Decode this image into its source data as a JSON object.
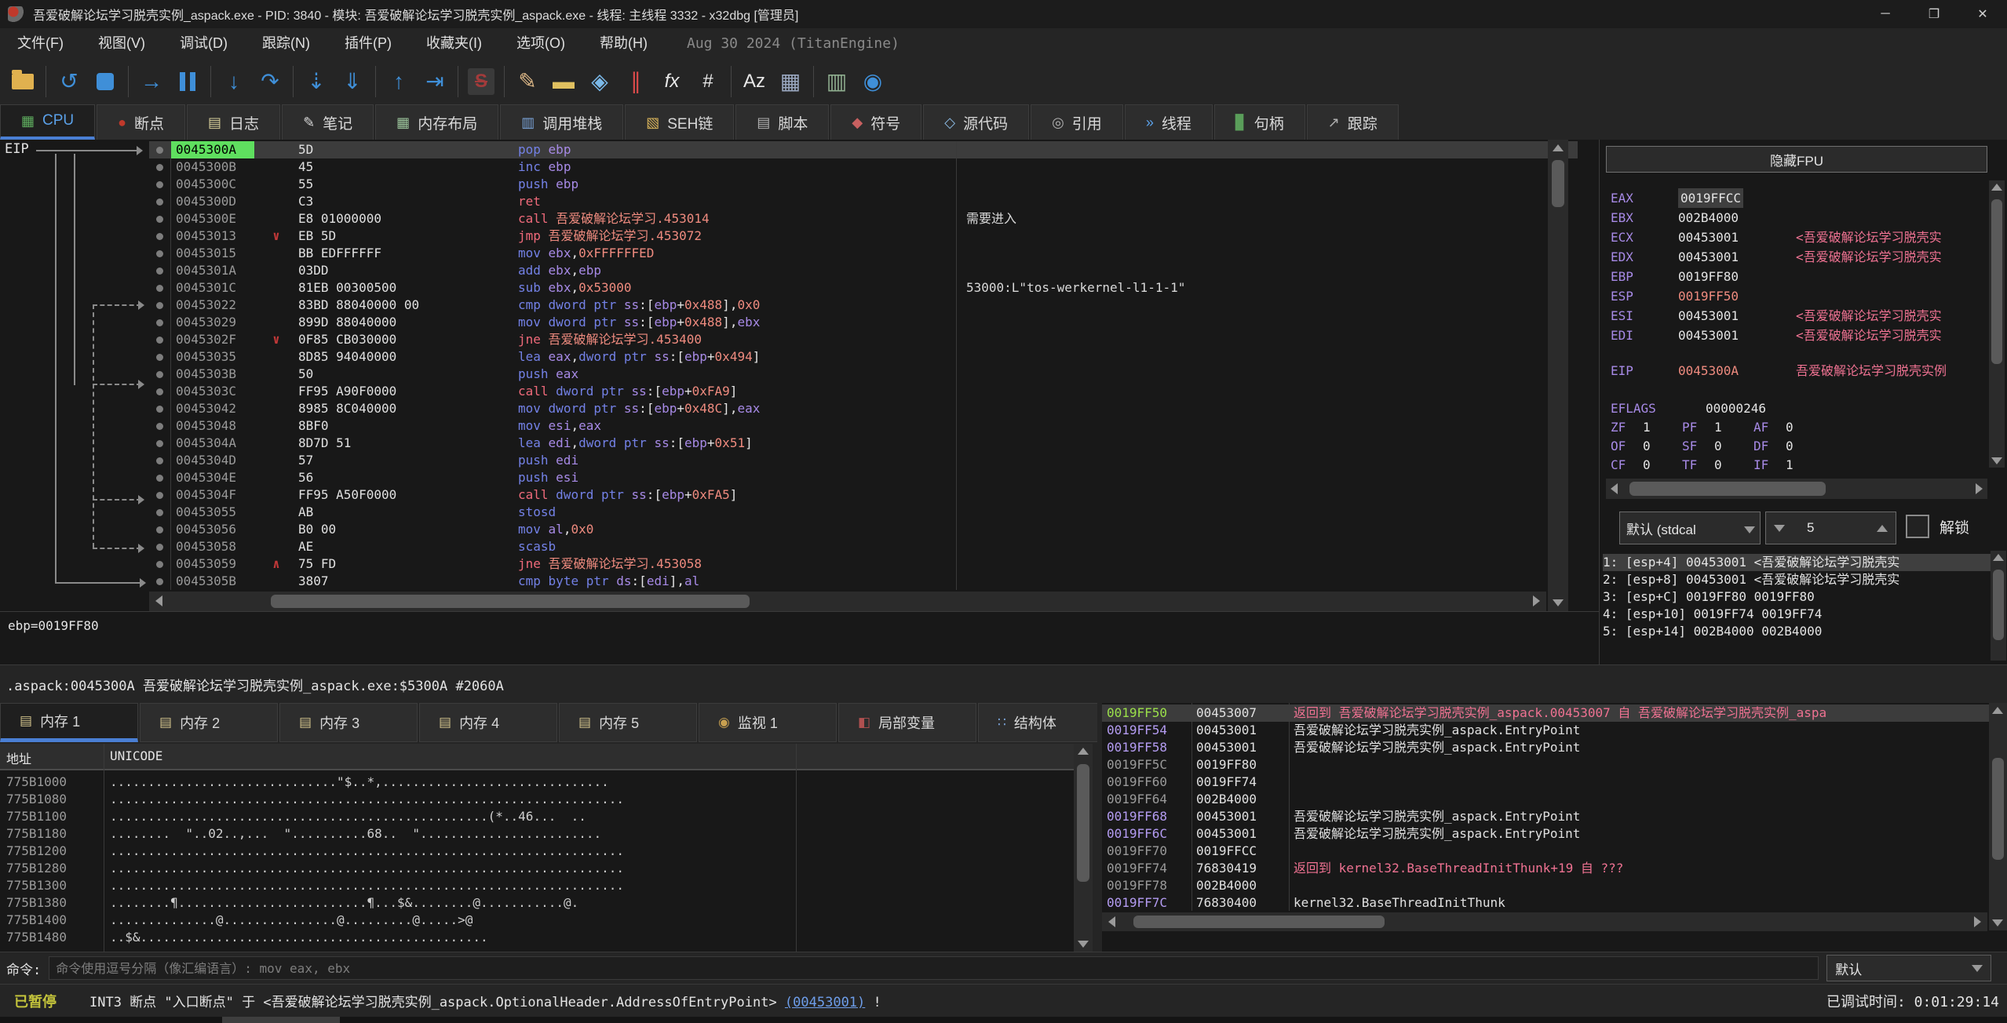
{
  "window": {
    "title": "吾爱破解论坛学习脱壳实例_aspack.exe - PID: 3840 - 模块: 吾爱破解论坛学习脱壳实例_aspack.exe - 线程: 主线程 3332 - x32dbg [管理员]",
    "controls": {
      "minimize": "─",
      "maximize": "❐",
      "close": "✕"
    }
  },
  "menu": {
    "items": [
      "文件(F)",
      "视图(V)",
      "调试(D)",
      "跟踪(N)",
      "插件(P)",
      "收藏夹(I)",
      "选项(O)",
      "帮助(H)"
    ],
    "build_note": "Aug 30 2024 (TitanEngine)"
  },
  "toolbar": {
    "icons": [
      {
        "name": "open-file-icon",
        "shape": "folder"
      },
      {
        "sep": true
      },
      {
        "name": "restart-icon",
        "glyph": "↺",
        "color": "#3f8fd8"
      },
      {
        "name": "stop-icon",
        "shape": "stop"
      },
      {
        "sep": true
      },
      {
        "name": "run-icon",
        "glyph": "→",
        "color": "#3f8fd8"
      },
      {
        "name": "pause-icon",
        "shape": "pause"
      },
      {
        "sep": true
      },
      {
        "name": "step-into-icon",
        "glyph": "↓",
        "color": "#3f8fd8"
      },
      {
        "name": "step-over-icon",
        "glyph": "↷",
        "color": "#3f8fd8"
      },
      {
        "sep": true
      },
      {
        "name": "trace-into-icon",
        "glyph": "⇣",
        "color": "#3f8fd8"
      },
      {
        "name": "trace-over-icon",
        "glyph": "⇓",
        "color": "#3f8fd8"
      },
      {
        "sep": true
      },
      {
        "name": "step-out-icon",
        "glyph": "↑",
        "color": "#3f8fd8"
      },
      {
        "name": "run-to-cursor-icon",
        "glyph": "⇥",
        "color": "#3f8fd8"
      },
      {
        "sep": true
      },
      {
        "name": "source-mode-icon",
        "shape": "stile"
      },
      {
        "sep": true
      },
      {
        "name": "patch-icon",
        "glyph": "✎",
        "color": "#deb887"
      },
      {
        "name": "comment-icon",
        "glyph": "▬",
        "color": "#e0c060"
      },
      {
        "name": "label-icon",
        "glyph": "◈",
        "color": "#7ab8e8"
      },
      {
        "name": "highlight-icon",
        "glyph": "∥",
        "color": "#d84a4a"
      },
      {
        "name": "function-icon",
        "glyph": "fx",
        "color": "#e8e8e8"
      },
      {
        "name": "hash-icon",
        "glyph": "#",
        "color": "#e8e8e8"
      },
      {
        "sep": true
      },
      {
        "name": "strings-icon",
        "glyph": "Az",
        "color": "#e8e8e8"
      },
      {
        "name": "calculator-icon",
        "glyph": "▦",
        "color": "#9aa8c0"
      },
      {
        "sep": true
      },
      {
        "name": "memory-map-icon",
        "glyph": "▥",
        "color": "#8fae8f"
      },
      {
        "name": "internet-icon",
        "glyph": "◉",
        "color": "#3f8fd8"
      }
    ]
  },
  "main_tabs": {
    "items": [
      {
        "label": "CPU",
        "icon": "cpu-icon",
        "glyph": "▦",
        "color": "#5fae5f",
        "active": true
      },
      {
        "label": "断点",
        "icon": "breakpoint-icon",
        "glyph": "●",
        "color": "#c0392b"
      },
      {
        "label": "日志",
        "icon": "log-icon",
        "glyph": "▤",
        "color": "#d8cf9a"
      },
      {
        "label": "笔记",
        "icon": "notes-icon",
        "glyph": "✎",
        "color": "#d8d8d8"
      },
      {
        "label": "内存布局",
        "icon": "memory-map-icon",
        "glyph": "▦",
        "color": "#9ac29a"
      },
      {
        "label": "调用堆栈",
        "icon": "call-stack-icon",
        "glyph": "▥",
        "color": "#7aa3d8"
      },
      {
        "label": "SEH链",
        "icon": "seh-chain-icon",
        "glyph": "▧",
        "color": "#d8b35a"
      },
      {
        "label": "脚本",
        "icon": "script-icon",
        "glyph": "▤",
        "color": "#b0b0b0"
      },
      {
        "label": "符号",
        "icon": "symbols-icon",
        "glyph": "◆",
        "color": "#c86060"
      },
      {
        "label": "源代码",
        "icon": "source-icon",
        "glyph": "◇",
        "color": "#8ab8e0"
      },
      {
        "label": "引用",
        "icon": "references-icon",
        "glyph": "◎",
        "color": "#b0b0b0"
      },
      {
        "label": "线程",
        "icon": "threads-icon",
        "glyph": "»",
        "color": "#5aa0e8"
      },
      {
        "label": "句柄",
        "icon": "handles-icon",
        "glyph": "▊",
        "color": "#5a9e5a"
      },
      {
        "label": "跟踪",
        "icon": "trace-icon",
        "glyph": "↗",
        "color": "#b0b0b0"
      }
    ]
  },
  "cpu": {
    "eip_label": "EIP",
    "info_line": "ebp=0019FF80",
    "module_line": ".aspack:0045300A 吾爱破解论坛学习脱壳实例_aspack.exe:$5300A #2060A",
    "disasm_rows": [
      {
        "addr": "0045300A",
        "bytes": "5D",
        "instr": "pop ebp",
        "selected": true
      },
      {
        "addr": "0045300B",
        "bytes": "45",
        "instr": "inc ebp"
      },
      {
        "addr": "0045300C",
        "bytes": "55",
        "instr": "push ebp"
      },
      {
        "addr": "0045300D",
        "bytes": "C3",
        "instr": "ret"
      },
      {
        "addr": "0045300E",
        "bytes": "E8 01000000",
        "instr": "call 吾爱破解论坛学习.453014",
        "comment": "需要进入"
      },
      {
        "addr": "00453013",
        "bytes": "EB 5D",
        "instr": "jmp 吾爱破解论坛学习.453072",
        "jump": "down"
      },
      {
        "addr": "00453015",
        "bytes": "BB EDFFFFFF",
        "instr": "mov ebx,0xFFFFFFED"
      },
      {
        "addr": "0045301A",
        "bytes": "03DD",
        "instr": "add ebx,ebp"
      },
      {
        "addr": "0045301C",
        "bytes": "81EB 00300500",
        "instr": "sub ebx,0x53000",
        "comment": "53000:L\"tos-werkernel-l1-1-1\""
      },
      {
        "addr": "00453022",
        "bytes": "83BD 88040000 00",
        "instr": "cmp dword ptr ss:[ebp+0x488],0x0"
      },
      {
        "addr": "00453029",
        "bytes": "899D 88040000",
        "instr": "mov dword ptr ss:[ebp+0x488],ebx"
      },
      {
        "addr": "0045302F",
        "bytes": "0F85 CB030000",
        "instr": "jne 吾爱破解论坛学习.453400",
        "jump": "down"
      },
      {
        "addr": "00453035",
        "bytes": "8D85 94040000",
        "instr": "lea eax,dword ptr ss:[ebp+0x494]"
      },
      {
        "addr": "0045303B",
        "bytes": "50",
        "instr": "push eax"
      },
      {
        "addr": "0045303C",
        "bytes": "FF95 A90F0000",
        "instr": "call dword ptr ss:[ebp+0xFA9]"
      },
      {
        "addr": "00453042",
        "bytes": "8985 8C040000",
        "instr": "mov dword ptr ss:[ebp+0x48C],eax"
      },
      {
        "addr": "00453048",
        "bytes": "8BF0",
        "instr": "mov esi,eax"
      },
      {
        "addr": "0045304A",
        "bytes": "8D7D 51",
        "instr": "lea edi,dword ptr ss:[ebp+0x51]"
      },
      {
        "addr": "0045304D",
        "bytes": "57",
        "instr": "push edi"
      },
      {
        "addr": "0045304E",
        "bytes": "56",
        "instr": "push esi"
      },
      {
        "addr": "0045304F",
        "bytes": "FF95 A50F0000",
        "instr": "call dword ptr ss:[ebp+0xFA5]"
      },
      {
        "addr": "00453055",
        "bytes": "AB",
        "instr": "stosd"
      },
      {
        "addr": "00453056",
        "bytes": "B0 00",
        "instr": "mov al,0x0"
      },
      {
        "addr": "00453058",
        "bytes": "AE",
        "instr": "scasb"
      },
      {
        "addr": "00453059",
        "bytes": "75 FD",
        "instr": "jne 吾爱破解论坛学习.453058",
        "jump": "up"
      },
      {
        "addr": "0045305B",
        "bytes": "3807",
        "instr": "cmp byte ptr ds:[edi],al"
      }
    ]
  },
  "registers": {
    "hide_fpu_label": "隐藏FPU",
    "rows": [
      {
        "name": "EAX",
        "value": "0019FFCC",
        "value_selected": true
      },
      {
        "name": "EBX",
        "value": "002B4000"
      },
      {
        "name": "ECX",
        "value": "00453001",
        "comment": "<吾爱破解论坛学习脱壳实"
      },
      {
        "name": "EDX",
        "value": "00453001",
        "comment": "<吾爱破解论坛学习脱壳实"
      },
      {
        "name": "EBP",
        "value": "0019FF80",
        "underline": "yellow"
      },
      {
        "name": "ESP",
        "value": "0019FF50",
        "underline": "red",
        "value_color": "red"
      },
      {
        "name": "ESI",
        "value": "00453001",
        "comment": "<吾爱破解论坛学习脱壳实"
      },
      {
        "name": "EDI",
        "value": "00453001",
        "comment": "<吾爱破解论坛学习脱壳实"
      }
    ],
    "eip": {
      "name": "EIP",
      "value": "0045300A",
      "comment": "吾爱破解论坛学习脱壳实例"
    },
    "eflags": {
      "name": "EFLAGS",
      "value": "00000246"
    },
    "flags": [
      [
        [
          "ZF",
          "1"
        ],
        [
          "PF",
          "1"
        ],
        [
          "AF",
          "0"
        ]
      ],
      [
        [
          "OF",
          "0"
        ],
        [
          "SF",
          "0"
        ],
        [
          "DF",
          "0"
        ]
      ],
      [
        [
          "CF",
          "0"
        ],
        [
          "TF",
          "0"
        ],
        [
          "IF",
          "1"
        ]
      ]
    ],
    "calling_convention": "默认 (stdcal",
    "arg_count": "5",
    "unlock_label": "解锁",
    "args": [
      {
        "text": "1: [esp+4] 00453001 <吾爱破解论坛学习脱壳实",
        "selected": true
      },
      {
        "text": "2: [esp+8] 00453001 <吾爱破解论坛学习脱壳实"
      },
      {
        "text": "3: [esp+C] 0019FF80 0019FF80"
      },
      {
        "text": "4: [esp+10] 0019FF74 0019FF74"
      },
      {
        "text": "5: [esp+14] 002B4000 002B4000"
      }
    ]
  },
  "bottom_tabs": {
    "items": [
      {
        "label": "内存 1",
        "icon": "memory-dump-icon",
        "glyph": "▤",
        "color": "#cfc08a",
        "active": true
      },
      {
        "label": "内存 2",
        "icon": "memory-dump-icon",
        "glyph": "▤",
        "color": "#cfc08a"
      },
      {
        "label": "内存 3",
        "icon": "memory-dump-icon",
        "glyph": "▤",
        "color": "#cfc08a"
      },
      {
        "label": "内存 4",
        "icon": "memory-dump-icon",
        "glyph": "▤",
        "color": "#cfc08a"
      },
      {
        "label": "内存 5",
        "icon": "memory-dump-icon",
        "glyph": "▤",
        "color": "#cfc08a"
      },
      {
        "label": "监视 1",
        "icon": "watch-icon",
        "glyph": "◉",
        "color": "#c8a050"
      },
      {
        "label": "局部变量",
        "icon": "locals-icon",
        "glyph": "◧",
        "color": "#b05050"
      },
      {
        "label": "结构体",
        "icon": "struct-icon",
        "glyph": "∷",
        "color": "#7aa3d8"
      }
    ]
  },
  "memory_dump": {
    "columns": {
      "addr": "地址",
      "unicode": "UNICODE"
    },
    "rows": [
      {
        "addr": "775B1000",
        "text": "..............................\"$..*,.............................."
      },
      {
        "addr": "775B1080",
        "text": "...................................................................."
      },
      {
        "addr": "775B1100",
        "text": "..................................................(*..46...  .."
      },
      {
        "addr": "775B1180",
        "text": "........  \"..02..,...  \"..........68..  \"........................"
      },
      {
        "addr": "775B1200",
        "text": "...................................................................."
      },
      {
        "addr": "775B1280",
        "text": "...................................................................."
      },
      {
        "addr": "775B1300",
        "text": "...................................................................."
      },
      {
        "addr": "775B1380",
        "text": "........¶.........................¶...$&........@...........@."
      },
      {
        "addr": "775B1400",
        "text": "..............@...............@.........@.....>@"
      },
      {
        "addr": "775B1480",
        "text": "..$&.............................................."
      }
    ]
  },
  "stack": {
    "rows": [
      {
        "addr": "0019FF50",
        "value": "00453007",
        "comment": "返回到 吾爱破解论坛学习脱壳实例_aspack.00453007 自 吾爱破解论坛学习脱壳实例_aspa",
        "selected": true,
        "comment_red": true
      },
      {
        "addr": "0019FF54",
        "value": "00453001",
        "comment": "吾爱破解论坛学习脱壳实例_aspack.EntryPoint",
        "addr_purple": true
      },
      {
        "addr": "0019FF58",
        "value": "00453001",
        "comment": "吾爱破解论坛学习脱壳实例_aspack.EntryPoint",
        "addr_purple": true
      },
      {
        "addr": "0019FF5C",
        "value": "0019FF80"
      },
      {
        "addr": "0019FF60",
        "value": "0019FF74"
      },
      {
        "addr": "0019FF64",
        "value": "002B4000"
      },
      {
        "addr": "0019FF68",
        "value": "00453001",
        "comment": "吾爱破解论坛学习脱壳实例_aspack.EntryPoint",
        "addr_purple": true
      },
      {
        "addr": "0019FF6C",
        "value": "00453001",
        "comment": "吾爱破解论坛学习脱壳实例_aspack.EntryPoint",
        "addr_purple": true
      },
      {
        "addr": "0019FF70",
        "value": "0019FFCC"
      },
      {
        "addr": "0019FF74",
        "value": "76830419",
        "comment": "返回到 kernel32.BaseThreadInitThunk+19 自 ???",
        "comment_red": true
      },
      {
        "addr": "0019FF78",
        "value": "002B4000"
      },
      {
        "addr": "0019FF7C",
        "value": "76830400",
        "comment": "kernel32.BaseThreadInitThunk",
        "addr_purple": true
      }
    ]
  },
  "command_bar": {
    "label": "命令:",
    "placeholder": "命令使用逗号分隔（像汇编语言）: mov eax, ebx",
    "profile": "默认"
  },
  "status_bar": {
    "state": "已暂停",
    "message_prefix": "INT3 断点 \"入口断点\" 于 <吾爱破解论坛学习脱壳实例_aspack.OptionalHeader.AddressOfEntryPoint> ",
    "link": "(00453001)",
    "message_suffix": " !",
    "time_label": "已调试时间: 0:01:29:14"
  }
}
